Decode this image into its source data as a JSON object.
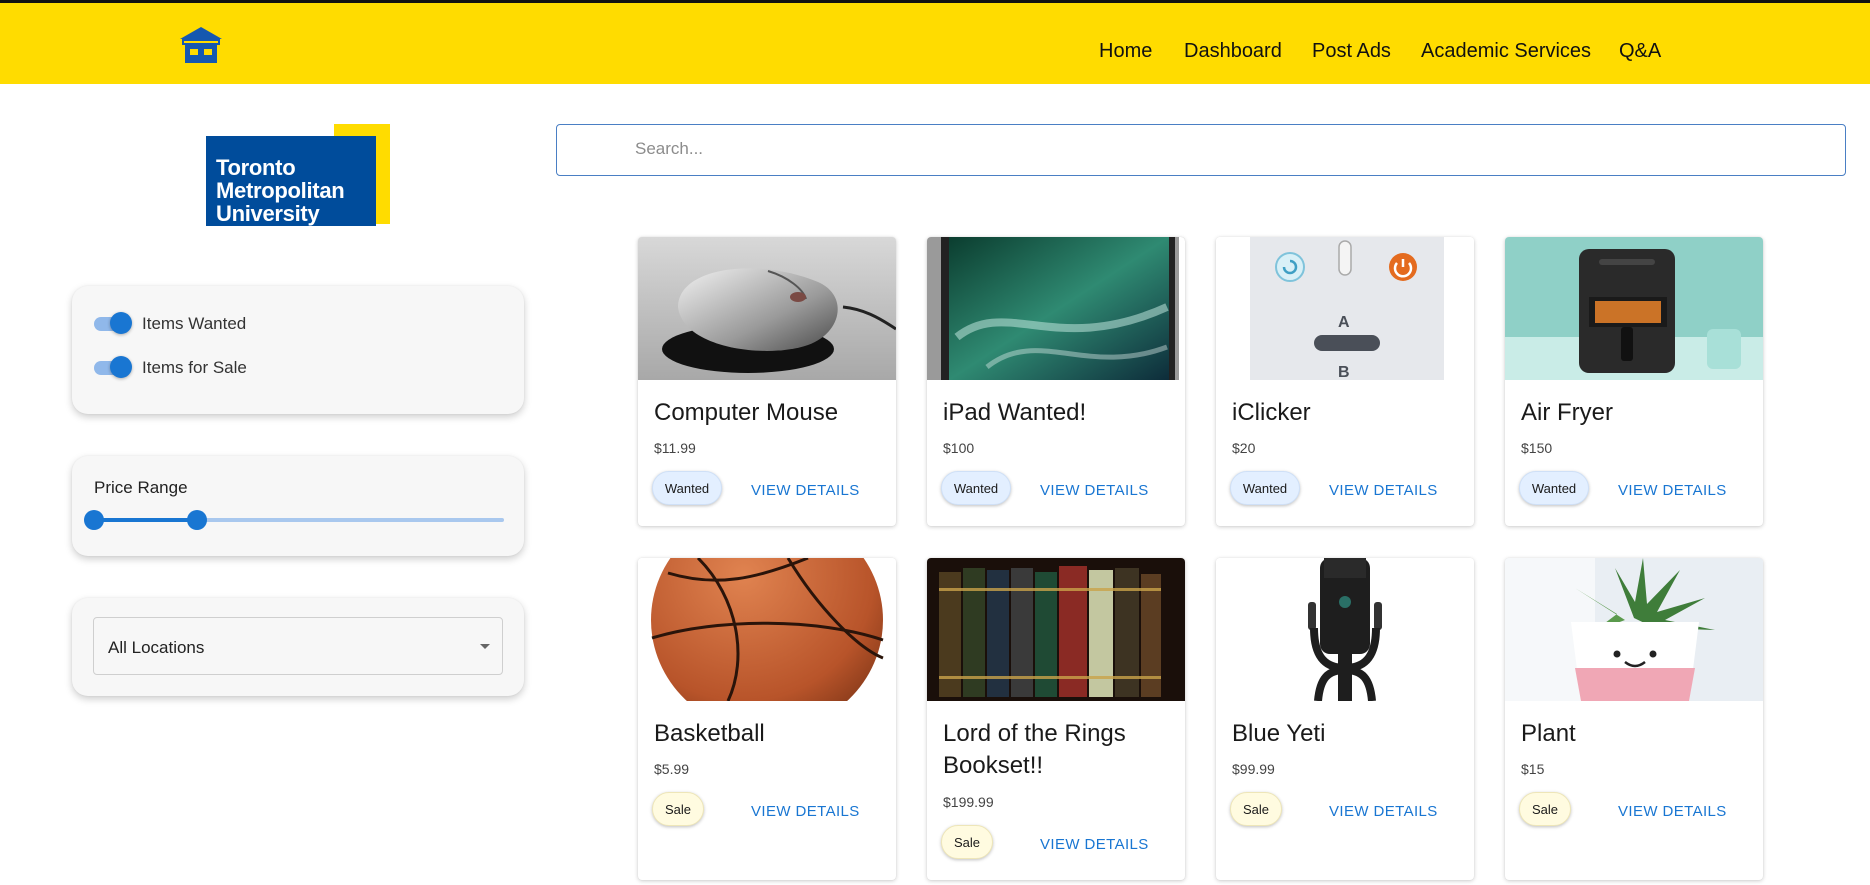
{
  "nav": {
    "home_logo_icon": "marketplace-store-icon",
    "links": [
      "Home",
      "Dashboard",
      "Post Ads",
      "Academic Services",
      "Q&A"
    ]
  },
  "sidebar": {
    "university_logo": {
      "line1": "Toronto",
      "line2": "Metropolitan",
      "line3": "University"
    },
    "toggles": [
      {
        "label": "Items Wanted",
        "checked": true
      },
      {
        "label": "Items for Sale",
        "checked": true
      }
    ],
    "price_range": {
      "label": "Price Range",
      "low_fraction": 0.0,
      "high_fraction": 0.25
    },
    "location_select": {
      "value": "All Locations"
    }
  },
  "search": {
    "placeholder": "Search..."
  },
  "listings": [
    {
      "title": "Computer Mouse",
      "price": "$11.99",
      "tag": "Wanted",
      "action": "VIEW DETAILS",
      "image": "computer-mouse-image"
    },
    {
      "title": "iPad Wanted!",
      "price": "$100",
      "tag": "Wanted",
      "action": "VIEW DETAILS",
      "image": "ipad-image"
    },
    {
      "title": "iClicker",
      "price": "$20",
      "tag": "Wanted",
      "action": "VIEW DETAILS",
      "image": "iclicker-image"
    },
    {
      "title": "Air Fryer",
      "price": "$150",
      "tag": "Wanted",
      "action": "VIEW DETAILS",
      "image": "air-fryer-image"
    },
    {
      "title": "Basketball",
      "price": "$5.99",
      "tag": "Sale",
      "action": "VIEW DETAILS",
      "image": "basketball-image"
    },
    {
      "title": "Lord of the Rings Bookset!!",
      "price": "$199.99",
      "tag": "Sale",
      "action": "VIEW DETAILS",
      "image": "books-image"
    },
    {
      "title": "Blue Yeti",
      "price": "$99.99",
      "tag": "Sale",
      "action": "VIEW DETAILS",
      "image": "microphone-image"
    },
    {
      "title": "Plant",
      "price": "$15",
      "tag": "Sale",
      "action": "VIEW DETAILS",
      "image": "plant-image"
    }
  ],
  "colors": {
    "header": "#FFDC00",
    "brand_blue": "#004C9B",
    "accent": "#1976d2"
  }
}
